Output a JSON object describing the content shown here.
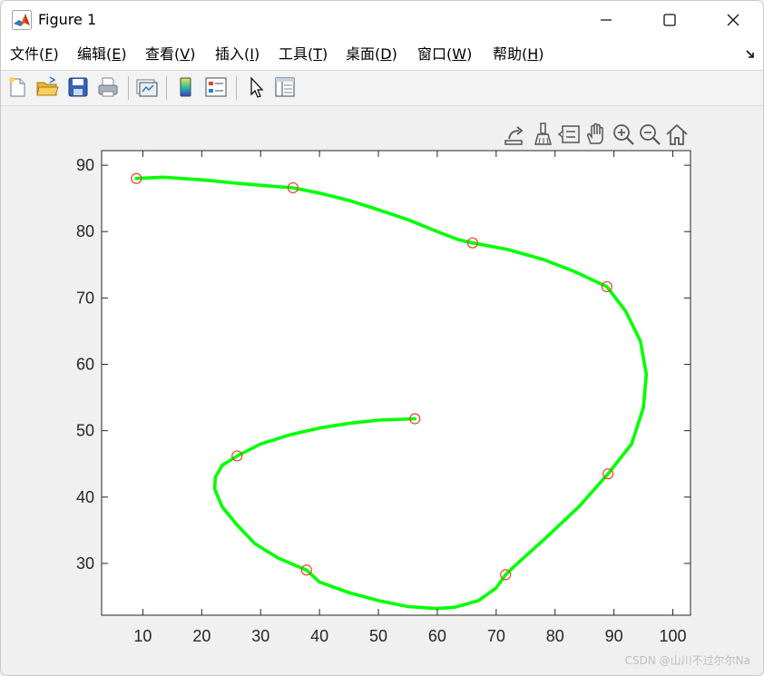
{
  "window": {
    "title": "Figure 1"
  },
  "menu": [
    {
      "label": "文件(",
      "mn": "F",
      "end": ")"
    },
    {
      "label": "编辑(",
      "mn": "E",
      "end": ")"
    },
    {
      "label": "查看(",
      "mn": "V",
      "end": ")"
    },
    {
      "label": "插入(",
      "mn": "I",
      "end": ")"
    },
    {
      "label": "工具(",
      "mn": "T",
      "end": ")"
    },
    {
      "label": "桌面(",
      "mn": "D",
      "end": ")"
    },
    {
      "label": "窗口(",
      "mn": "W",
      "end": ")"
    },
    {
      "label": "帮助(",
      "mn": "H",
      "end": ")"
    }
  ],
  "toolbar": {
    "buttons": [
      "new-figure-icon",
      "open-file-icon",
      "save-icon",
      "print-icon",
      "link-plot-icon",
      "insert-colorbar-icon",
      "insert-legend-icon",
      "edit-plot-arrow-icon",
      "property-inspector-icon"
    ]
  },
  "axes_toolbar": {
    "buttons": [
      "export-icon",
      "data-brush-icon",
      "data-tips-icon",
      "pan-hand-icon",
      "zoom-in-icon",
      "zoom-out-icon",
      "restore-view-home-icon"
    ]
  },
  "watermark": "CSDN @山川不过尔尔Na",
  "colors": {
    "curve": "#00ff00",
    "markers": "#e8442a",
    "axes": "#262626"
  },
  "chart_data": {
    "type": "line",
    "xlim": [
      3,
      103
    ],
    "ylim": [
      22.2,
      92.2
    ],
    "xticks": [
      10,
      20,
      30,
      40,
      50,
      60,
      70,
      80,
      90,
      100
    ],
    "yticks": [
      30,
      40,
      50,
      60,
      70,
      80,
      90
    ],
    "grid": false,
    "series": [
      {
        "style": "circles",
        "x": [
          8.9,
          35.5,
          66.0,
          88.8,
          89.0,
          71.6,
          37.8,
          26.0,
          56.2
        ],
        "y": [
          88.0,
          86.6,
          78.3,
          71.7,
          43.5,
          28.3,
          29.0,
          46.2,
          51.8
        ]
      },
      {
        "style": "smooth-line",
        "x": [
          8.9,
          13.5,
          20,
          27,
          32.5,
          35.5,
          40,
          45,
          50,
          55,
          60,
          63.5,
          66.0,
          72,
          78,
          83,
          88.8,
          92,
          94.5,
          95.5,
          95,
          93,
          89.0,
          84,
          78,
          73,
          71.6,
          70,
          67,
          63,
          60,
          55,
          50,
          45,
          40,
          37.8,
          33,
          29,
          26,
          23.5,
          22.2,
          22.3,
          23.5,
          26.0,
          30,
          35,
          40,
          45,
          50,
          56.2
        ],
        "y": [
          88.0,
          88.2,
          87.8,
          87.2,
          86.8,
          86.6,
          85.8,
          84.7,
          83.3,
          81.8,
          80.0,
          78.8,
          78.3,
          77.3,
          75.8,
          74.1,
          71.7,
          68.0,
          63.5,
          58.5,
          53.5,
          48.0,
          43.5,
          38.5,
          33.5,
          29.5,
          28.3,
          26.3,
          24.4,
          23.4,
          23.2,
          23.5,
          24.4,
          25.6,
          27.2,
          29.0,
          30.8,
          33.0,
          35.8,
          38.5,
          41.2,
          43.0,
          44.8,
          46.2,
          48.0,
          49.4,
          50.4,
          51.1,
          51.6,
          51.8
        ]
      }
    ]
  }
}
